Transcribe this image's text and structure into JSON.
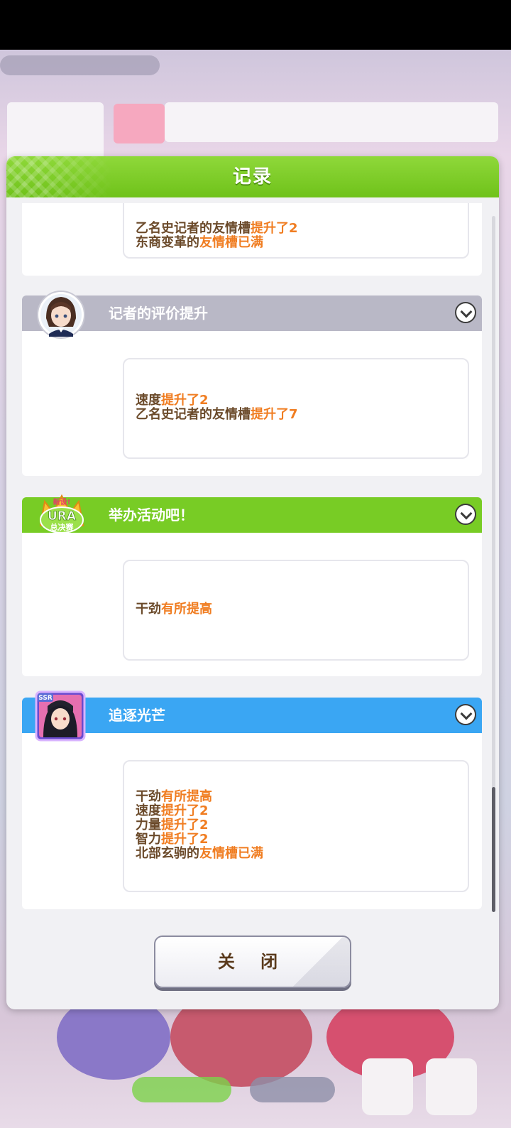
{
  "modal": {
    "title": "记录",
    "close_label": "关 闭"
  },
  "cards": [
    {
      "partial": true,
      "lines": [
        [
          {
            "t": "乙名史记者的友情槽",
            "h": false
          },
          {
            "t": "提升了2",
            "h": true
          }
        ],
        [
          {
            "t": "东商变革的",
            "h": false
          },
          {
            "t": "友情槽已满",
            "h": true
          }
        ]
      ]
    },
    {
      "title": "记者的评价提升",
      "header_color": "#b9b8c6",
      "icon": "reporter-avatar-icon",
      "lines": [
        [
          {
            "t": "速度",
            "h": false
          },
          {
            "t": "提升了2",
            "h": true
          }
        ],
        [
          {
            "t": "乙名史记者的友情槽",
            "h": false
          },
          {
            "t": "提升了7",
            "h": true
          }
        ]
      ]
    },
    {
      "title": "举办活动吧！",
      "header_color": "#78cc25",
      "icon": "ura-finals-badge-icon",
      "badge_top": "新设!",
      "badge_mid": "URA",
      "badge_bottom": "总决赛",
      "lines": [
        [
          {
            "t": "干劲",
            "h": false
          },
          {
            "t": "有所提高",
            "h": true
          }
        ]
      ]
    },
    {
      "title": "追逐光芒",
      "header_color": "#3aa6f3",
      "icon": "ssr-support-card-icon",
      "card_rank": "SSR",
      "lines": [
        [
          {
            "t": "干劲",
            "h": false
          },
          {
            "t": "有所提高",
            "h": true
          }
        ],
        [
          {
            "t": "速度",
            "h": false
          },
          {
            "t": "提升了2",
            "h": true
          }
        ],
        [
          {
            "t": "力量",
            "h": false
          },
          {
            "t": "提升了2",
            "h": true
          }
        ],
        [
          {
            "t": "智力",
            "h": false
          },
          {
            "t": "提升了2",
            "h": true
          }
        ],
        [
          {
            "t": "北部玄驹的",
            "h": false
          },
          {
            "t": "友情槽已满",
            "h": true
          }
        ]
      ]
    }
  ]
}
